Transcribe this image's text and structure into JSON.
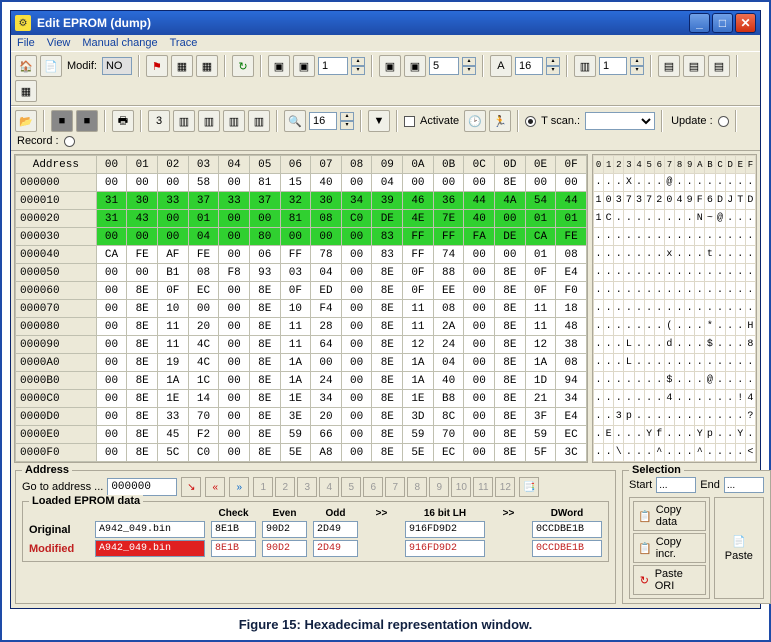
{
  "window": {
    "title": "Edit EPROM (dump)"
  },
  "menu": [
    "File",
    "View",
    "Manual change",
    "Trace"
  ],
  "toolbar1": {
    "modif_label": "Modif:",
    "modif_value": "NO",
    "spin1": "1",
    "spin2": "5",
    "spin3": "16",
    "spin4": "1"
  },
  "toolbar2": {
    "spin_find": "16",
    "activate_label": "Activate",
    "tscan_label": "T scan.:",
    "update_label": "Update :",
    "record_label": "Record :"
  },
  "hex": {
    "addr_header": "Address",
    "cols": [
      "00",
      "01",
      "02",
      "03",
      "04",
      "05",
      "06",
      "07",
      "08",
      "09",
      "0A",
      "0B",
      "0C",
      "0D",
      "0E",
      "0F"
    ],
    "rows": [
      {
        "addr": "000000",
        "cells": [
          "00",
          "00",
          "00",
          "58",
          "00",
          "81",
          "15",
          "40",
          "00",
          "04",
          "00",
          "00",
          "00",
          "8E",
          "00",
          "00"
        ],
        "hl": false
      },
      {
        "addr": "000010",
        "cells": [
          "31",
          "30",
          "33",
          "37",
          "33",
          "37",
          "32",
          "30",
          "34",
          "39",
          "46",
          "36",
          "44",
          "4A",
          "54",
          "44"
        ],
        "hl": true
      },
      {
        "addr": "000020",
        "cells": [
          "31",
          "43",
          "00",
          "01",
          "00",
          "00",
          "81",
          "08",
          "C0",
          "DE",
          "4E",
          "7E",
          "40",
          "00",
          "01",
          "01"
        ],
        "hl": true
      },
      {
        "addr": "000030",
        "cells": [
          "00",
          "00",
          "00",
          "04",
          "00",
          "80",
          "00",
          "00",
          "00",
          "83",
          "FF",
          "FF",
          "FA",
          "DE",
          "CA",
          "FE"
        ],
        "hl": true
      },
      {
        "addr": "000040",
        "cells": [
          "CA",
          "FE",
          "AF",
          "FE",
          "00",
          "06",
          "FF",
          "78",
          "00",
          "83",
          "FF",
          "74",
          "00",
          "00",
          "01",
          "08"
        ],
        "hl": false
      },
      {
        "addr": "000050",
        "cells": [
          "00",
          "00",
          "B1",
          "08",
          "F8",
          "93",
          "03",
          "04",
          "00",
          "8E",
          "0F",
          "88",
          "00",
          "8E",
          "0F",
          "E4"
        ],
        "hl": false
      },
      {
        "addr": "000060",
        "cells": [
          "00",
          "8E",
          "0F",
          "EC",
          "00",
          "8E",
          "0F",
          "ED",
          "00",
          "8E",
          "0F",
          "EE",
          "00",
          "8E",
          "0F",
          "F0"
        ],
        "hl": false
      },
      {
        "addr": "000070",
        "cells": [
          "00",
          "8E",
          "10",
          "00",
          "00",
          "8E",
          "10",
          "F4",
          "00",
          "8E",
          "11",
          "08",
          "00",
          "8E",
          "11",
          "18"
        ],
        "hl": false
      },
      {
        "addr": "000080",
        "cells": [
          "00",
          "8E",
          "11",
          "20",
          "00",
          "8E",
          "11",
          "28",
          "00",
          "8E",
          "11",
          "2A",
          "00",
          "8E",
          "11",
          "48"
        ],
        "hl": false
      },
      {
        "addr": "000090",
        "cells": [
          "00",
          "8E",
          "11",
          "4C",
          "00",
          "8E",
          "11",
          "64",
          "00",
          "8E",
          "12",
          "24",
          "00",
          "8E",
          "12",
          "38"
        ],
        "hl": false
      },
      {
        "addr": "0000A0",
        "cells": [
          "00",
          "8E",
          "19",
          "4C",
          "00",
          "8E",
          "1A",
          "00",
          "00",
          "8E",
          "1A",
          "04",
          "00",
          "8E",
          "1A",
          "08"
        ],
        "hl": false
      },
      {
        "addr": "0000B0",
        "cells": [
          "00",
          "8E",
          "1A",
          "1C",
          "00",
          "8E",
          "1A",
          "24",
          "00",
          "8E",
          "1A",
          "40",
          "00",
          "8E",
          "1D",
          "94"
        ],
        "hl": false
      },
      {
        "addr": "0000C0",
        "cells": [
          "00",
          "8E",
          "1E",
          "14",
          "00",
          "8E",
          "1E",
          "34",
          "00",
          "8E",
          "1E",
          "B8",
          "00",
          "8E",
          "21",
          "34"
        ],
        "hl": false
      },
      {
        "addr": "0000D0",
        "cells": [
          "00",
          "8E",
          "33",
          "70",
          "00",
          "8E",
          "3E",
          "20",
          "00",
          "8E",
          "3D",
          "8C",
          "00",
          "8E",
          "3F",
          "E4"
        ],
        "hl": false
      },
      {
        "addr": "0000E0",
        "cells": [
          "00",
          "8E",
          "45",
          "F2",
          "00",
          "8E",
          "59",
          "66",
          "00",
          "8E",
          "59",
          "70",
          "00",
          "8E",
          "59",
          "EC"
        ],
        "hl": false
      },
      {
        "addr": "0000F0",
        "cells": [
          "00",
          "8E",
          "5C",
          "C0",
          "00",
          "8E",
          "5E",
          "A8",
          "00",
          "8E",
          "5E",
          "EC",
          "00",
          "8E",
          "5F",
          "3C"
        ],
        "hl": false
      }
    ]
  },
  "ascii": {
    "cols": [
      "0",
      "1",
      "2",
      "3",
      "4",
      "5",
      "6",
      "7",
      "8",
      "9",
      "A",
      "B",
      "C",
      "D",
      "E",
      "F"
    ],
    "rows": [
      [
        ".",
        ".",
        ".",
        "X",
        ".",
        ".",
        ".",
        "@",
        ".",
        ".",
        ".",
        ".",
        ".",
        ".",
        ".",
        "."
      ],
      [
        "1",
        "0",
        "3",
        "7",
        "3",
        "7",
        "2",
        "0",
        "4",
        "9",
        "F",
        "6",
        "D",
        "J",
        "T",
        "D"
      ],
      [
        "1",
        "C",
        ".",
        ".",
        ".",
        ".",
        ".",
        ".",
        ".",
        ".",
        "N",
        "~",
        "@",
        ".",
        ".",
        "."
      ],
      [
        ".",
        ".",
        ".",
        ".",
        ".",
        ".",
        ".",
        ".",
        ".",
        ".",
        ".",
        ".",
        ".",
        ".",
        ".",
        "."
      ],
      [
        ".",
        ".",
        ".",
        ".",
        ".",
        ".",
        ".",
        "x",
        ".",
        ".",
        ".",
        "t",
        ".",
        ".",
        ".",
        "."
      ],
      [
        ".",
        ".",
        ".",
        ".",
        ".",
        ".",
        ".",
        ".",
        ".",
        ".",
        ".",
        ".",
        ".",
        ".",
        ".",
        "."
      ],
      [
        ".",
        ".",
        ".",
        ".",
        ".",
        ".",
        ".",
        ".",
        ".",
        ".",
        ".",
        ".",
        ".",
        ".",
        ".",
        "."
      ],
      [
        ".",
        ".",
        ".",
        ".",
        ".",
        ".",
        ".",
        ".",
        ".",
        ".",
        ".",
        ".",
        ".",
        ".",
        ".",
        "."
      ],
      [
        ".",
        ".",
        ".",
        ".",
        ".",
        ".",
        ".",
        "(",
        ".",
        ".",
        ".",
        "*",
        ".",
        ".",
        ".",
        "H"
      ],
      [
        ".",
        ".",
        ".",
        "L",
        ".",
        ".",
        ".",
        "d",
        ".",
        ".",
        ".",
        "$",
        ".",
        ".",
        ".",
        "8"
      ],
      [
        ".",
        ".",
        ".",
        "L",
        ".",
        ".",
        ".",
        ".",
        ".",
        ".",
        ".",
        ".",
        ".",
        ".",
        ".",
        "."
      ],
      [
        ".",
        ".",
        ".",
        ".",
        ".",
        ".",
        ".",
        "$",
        ".",
        ".",
        ".",
        "@",
        ".",
        ".",
        ".",
        "."
      ],
      [
        ".",
        ".",
        ".",
        ".",
        ".",
        ".",
        ".",
        "4",
        ".",
        ".",
        ".",
        ".",
        ".",
        ".",
        "!",
        "4"
      ],
      [
        ".",
        ".",
        "3",
        "p",
        ".",
        ".",
        ".",
        ".",
        ".",
        ".",
        ".",
        ".",
        ".",
        ".",
        ".",
        "?"
      ],
      [
        ".",
        "E",
        ".",
        ".",
        ".",
        "Y",
        "f",
        ".",
        ".",
        ".",
        "Y",
        "p",
        ".",
        ".",
        "Y",
        "."
      ],
      [
        ".",
        ".",
        "\\",
        ".",
        ".",
        ".",
        "^",
        ".",
        ".",
        ".",
        "^",
        ".",
        ".",
        ".",
        ".",
        "<"
      ]
    ]
  },
  "address_group": {
    "legend": "Address",
    "goto_label": "Go to address ...",
    "goto_value": "000000",
    "nums": [
      "1",
      "2",
      "3",
      "4",
      "5",
      "6",
      "7",
      "8",
      "9",
      "10",
      "11",
      "12"
    ]
  },
  "loaded": {
    "legend": "Loaded EPROM data",
    "check_label": "Check",
    "even_label": "Even",
    "odd_label": "Odd",
    "lh16_label": "16 bit LH",
    "dword_label": "DWord",
    "arrow": ">>",
    "original_label": "Original",
    "modified_label": "Modified",
    "original_file": "A942_049.bin",
    "modified_file": "A942_049.bin",
    "ori": {
      "check": "8E1B",
      "even": "90D2",
      "odd": "2D49",
      "lh": "916FD9D2",
      "dw": "0CCDBE1B"
    },
    "mod": {
      "check": "8E1B",
      "even": "90D2",
      "odd": "2D49",
      "lh": "916FD9D2",
      "dw": "0CCDBE1B"
    }
  },
  "selection": {
    "legend": "Selection",
    "start_label": "Start",
    "end_label": "End",
    "start_val": "...",
    "end_val": "...",
    "copy_data": "Copy data",
    "copy_incr": "Copy incr.",
    "paste_ori": "Paste ORI",
    "paste": "Paste"
  },
  "caption": "Figure 15: Hexadecimal representation window."
}
